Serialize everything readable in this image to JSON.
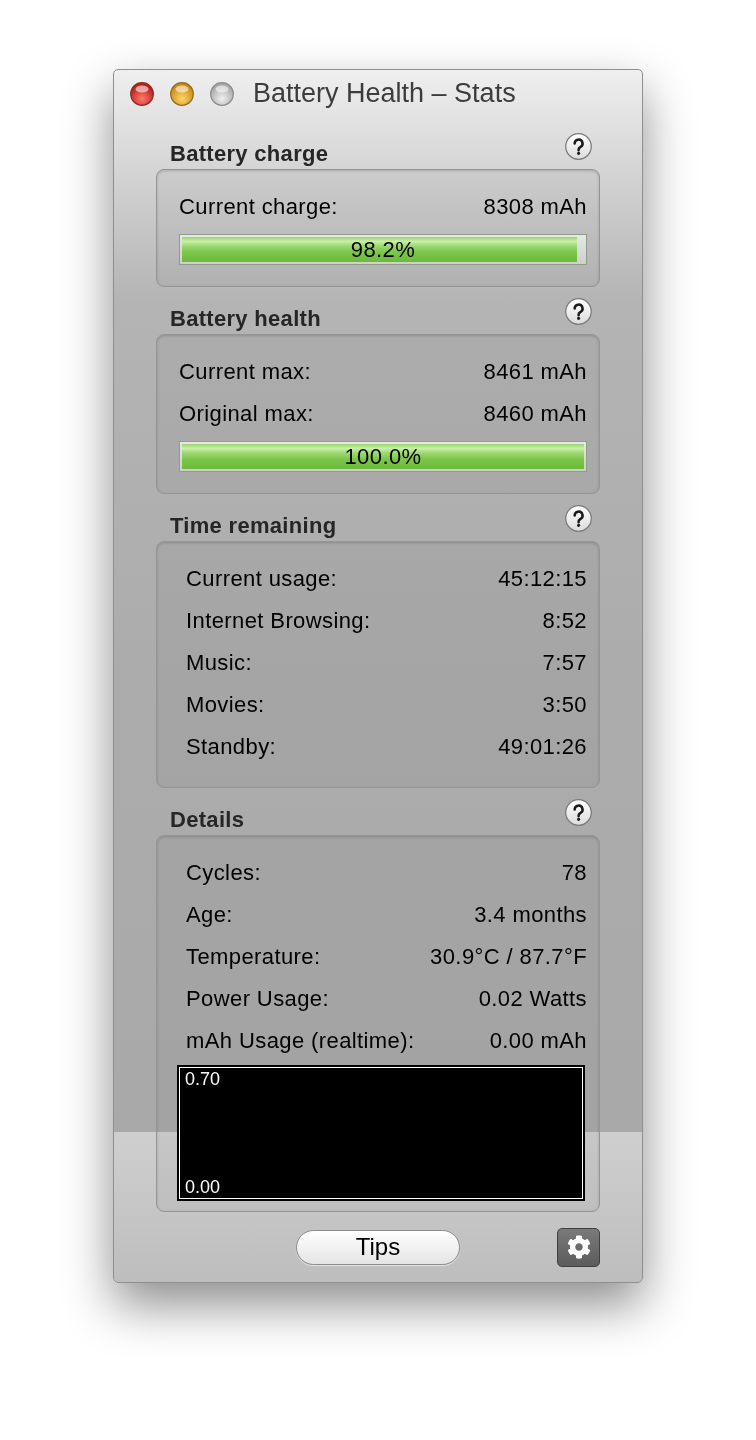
{
  "window": {
    "title": "Battery Health – Stats",
    "zoom_enabled": false
  },
  "sections": [
    {
      "title": "Battery charge",
      "rows": [
        {
          "label": "Current charge:",
          "value": "8308 mAh"
        }
      ],
      "bar": {
        "level": 0.982,
        "reading": "98.2%"
      }
    },
    {
      "title": "Battery health",
      "rows": [
        {
          "label": "Current max:",
          "value": "8461 mAh"
        },
        {
          "label": "Original max:",
          "value": "8460 mAh"
        }
      ],
      "bar": {
        "level": 1,
        "reading": "100.0%"
      }
    },
    {
      "title": "Time remaining",
      "rows": [
        {
          "label": "Current usage:",
          "value": "45:12:15"
        },
        {
          "label": "Internet Browsing:",
          "value": "8:52"
        },
        {
          "label": "Music:",
          "value": "7:57"
        },
        {
          "label": "Movies:",
          "value": "3:50"
        },
        {
          "label": "Standby:",
          "value": "49:01:26"
        }
      ]
    },
    {
      "title": "Details",
      "rows": [
        {
          "label": "Cycles:",
          "value": "78"
        },
        {
          "label": "Age:",
          "value": "3.4 months"
        },
        {
          "label": "Temperature:",
          "value": "30.9°C / 87.7°F"
        },
        {
          "label": "Power Usage:",
          "value": "0.02 Watts"
        },
        {
          "label": "mAh Usage (realtime):",
          "value": "0.00 mAh"
        }
      ],
      "graph": {
        "top_label": "0.70",
        "bottom_label": "0.00"
      }
    }
  ],
  "footer": {
    "tips_button": "Tips"
  }
}
